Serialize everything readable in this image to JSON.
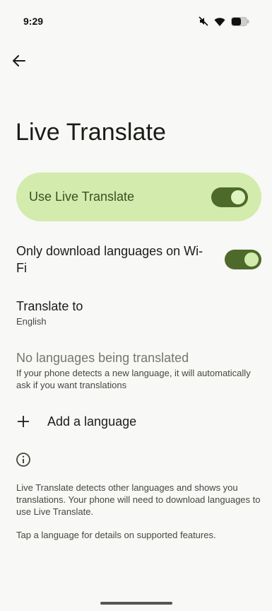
{
  "status_bar": {
    "time": "9:29",
    "icons": [
      "mute-icon",
      "wifi-icon",
      "battery-icon"
    ]
  },
  "header": {
    "back_icon": "arrow-back-icon",
    "title": "Live Translate"
  },
  "main_switch": {
    "label": "Use Live Translate",
    "checked": true
  },
  "settings": {
    "wifi_only": {
      "label": "Only download languages on Wi-Fi",
      "checked": true
    },
    "translate_to": {
      "label": "Translate to",
      "value": "English"
    },
    "no_languages": {
      "title": "No languages being translated",
      "description": "If your phone detects a new language, it will automatically ask if you want translations"
    },
    "add_language": {
      "label": "Add a language",
      "icon": "plus-icon"
    }
  },
  "footer": {
    "info_icon": "info-icon",
    "text_1": "Live Translate detects other languages and shows you translations. Your phone will need to download languages to use Live Translate.",
    "text_2": "Tap a language for details on supported features."
  },
  "colors": {
    "background": "#f8f8f6",
    "card": "#d3ebad",
    "toggle_track": "#4d6a2b",
    "toggle_thumb": "#dff3c0"
  }
}
